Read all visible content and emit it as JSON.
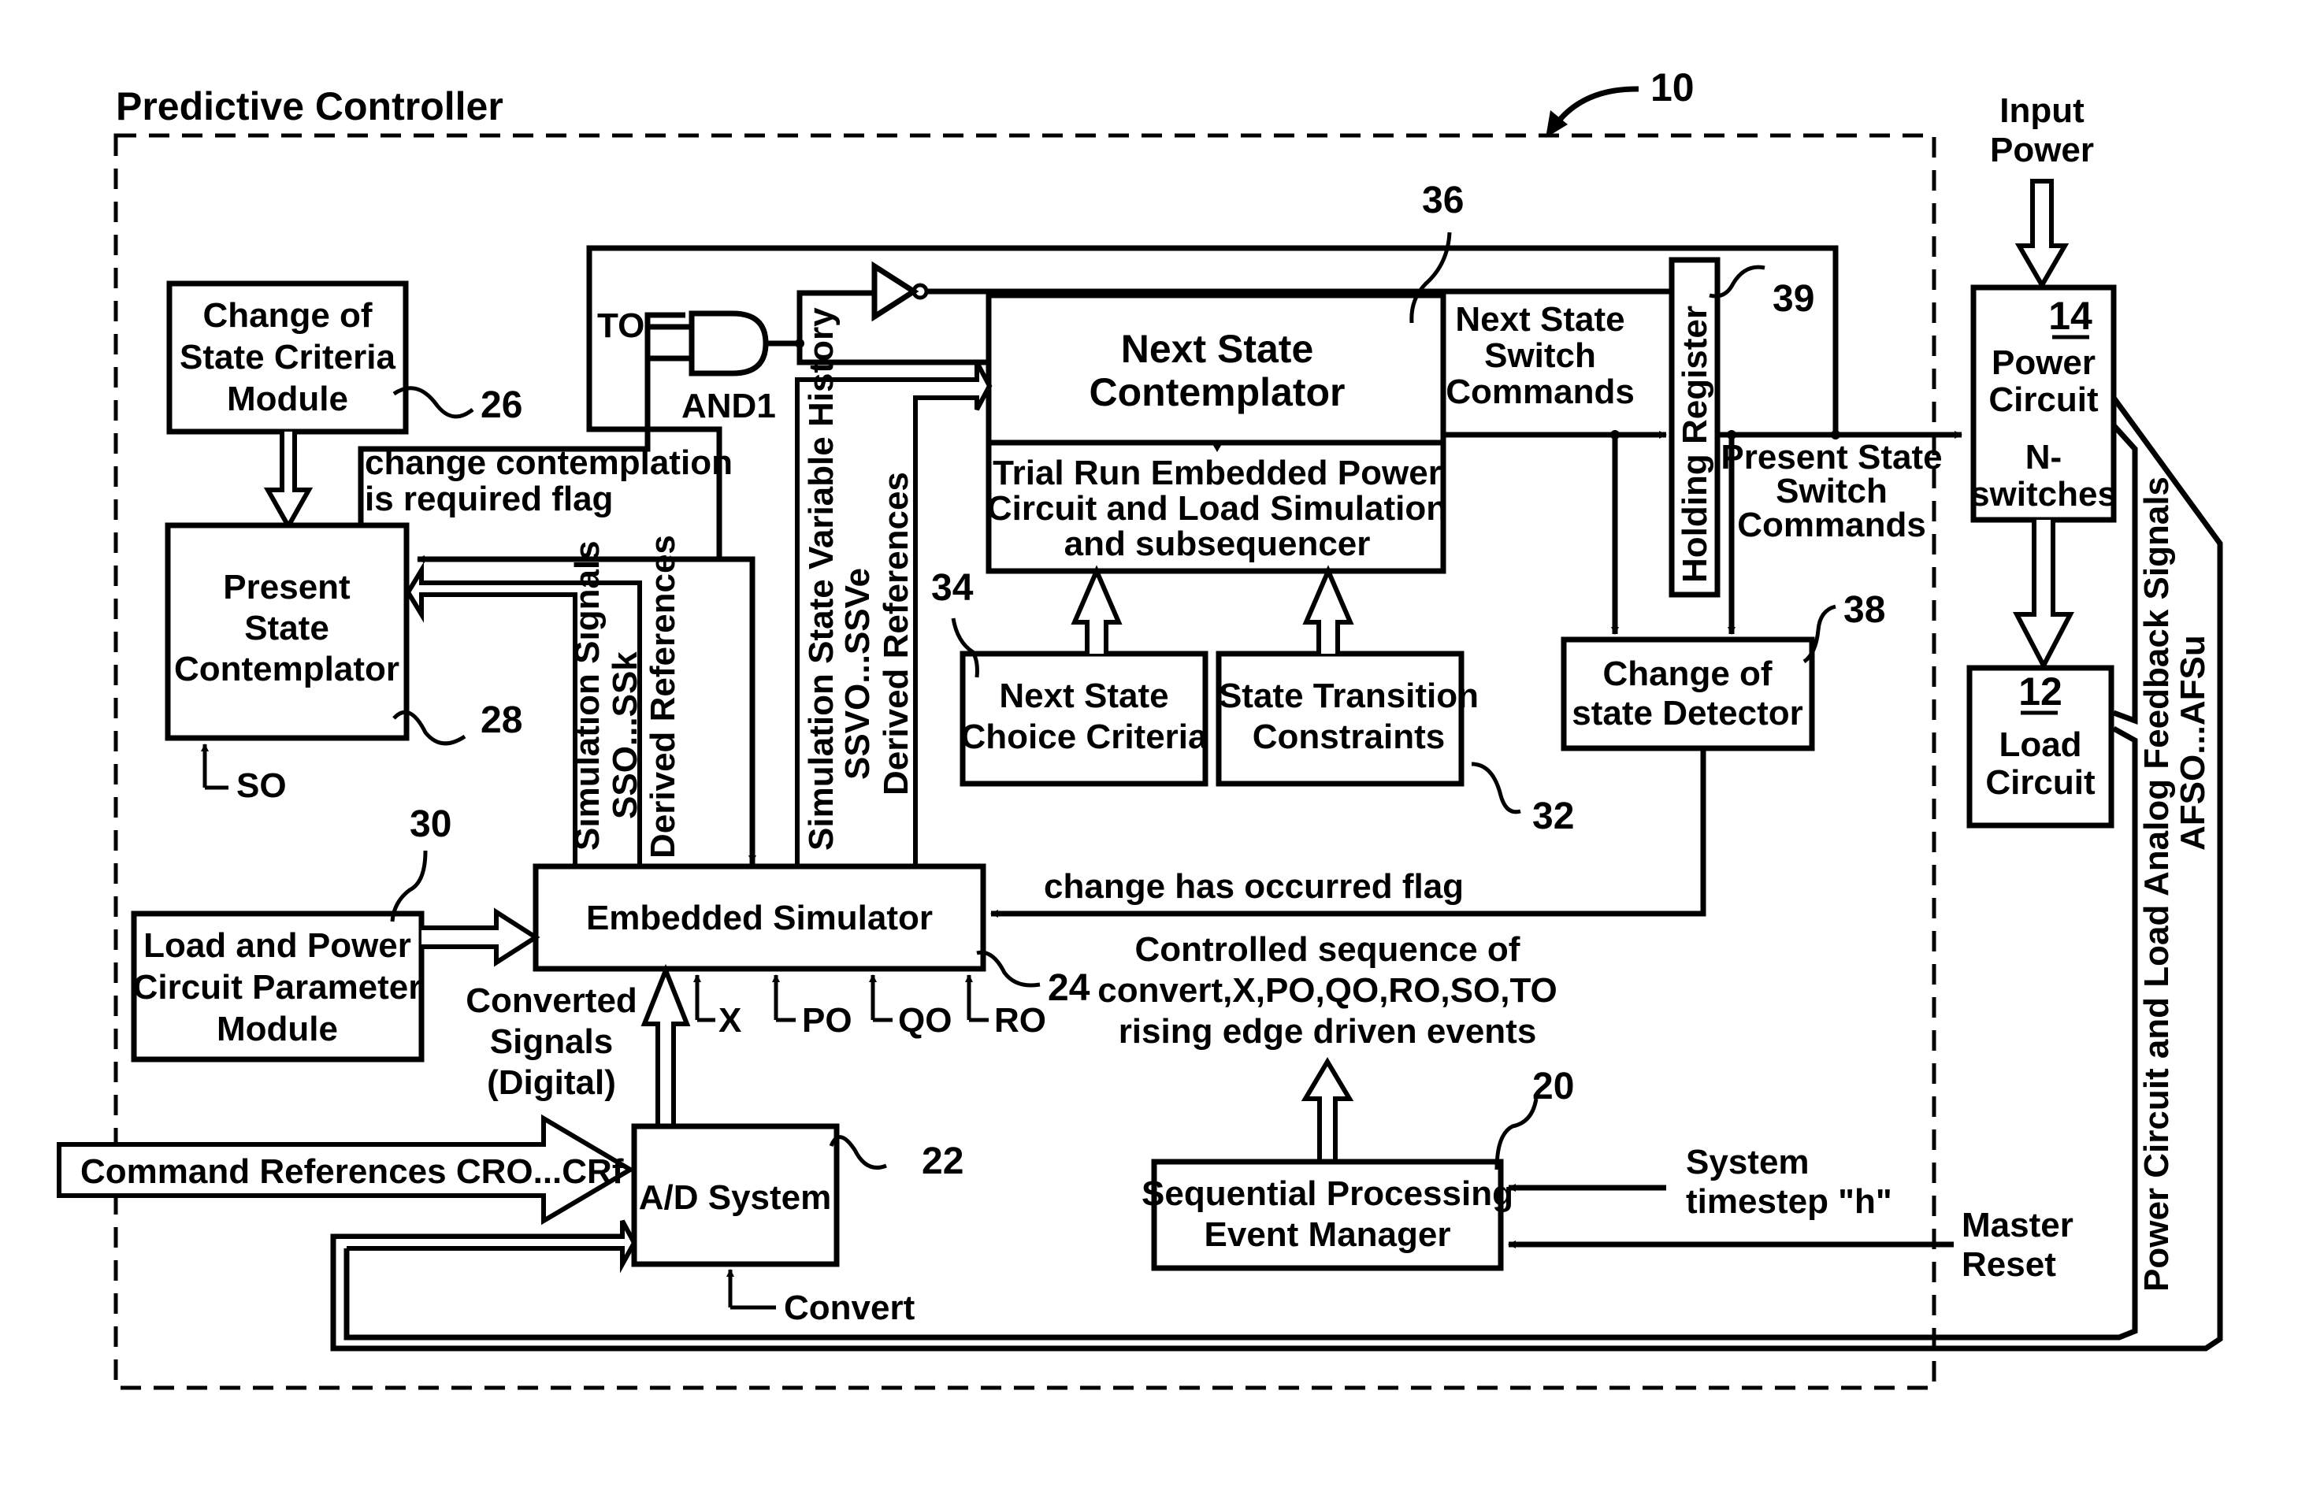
{
  "figure": {
    "title": "Predictive Controller",
    "ref_main": "10"
  },
  "blocks": {
    "change_criteria": {
      "lines": [
        "Change of",
        "State Criteria",
        "Module"
      ],
      "ref": "26"
    },
    "present_state": {
      "lines": [
        "Present",
        "State",
        "Contemplator"
      ],
      "ref": "28",
      "input": "SO"
    },
    "next_state": {
      "title_lines": [
        "Next State",
        "Contemplator"
      ],
      "sub_lines": [
        "Trial Run Embedded Power",
        "Circuit and Load Simulation",
        "and subsequencer"
      ],
      "ref": "36"
    },
    "holding_register": {
      "label": "Holding Register",
      "ref": "39"
    },
    "power_circuit": {
      "ref": "14",
      "lines": [
        "Power",
        "Circuit",
        "N-",
        "switches"
      ]
    },
    "load_circuit": {
      "ref": "12",
      "lines": [
        "Load",
        "Circuit"
      ]
    },
    "choice_criteria": {
      "lines": [
        "Next State",
        "Choice Criteria"
      ],
      "ref": "34"
    },
    "transition_constraints": {
      "lines": [
        "State Transition",
        "Constraints"
      ],
      "ref": "32"
    },
    "change_detector": {
      "lines": [
        "Change of",
        "state Detector"
      ],
      "ref": "38"
    },
    "embedded_simulator": {
      "label": "Embedded Simulator",
      "ref": "24",
      "inputs": [
        "X",
        "PO",
        "QO",
        "RO"
      ]
    },
    "param_module": {
      "lines": [
        "Load and Power",
        "Circuit Parameter",
        "Module"
      ],
      "ref": "30"
    },
    "ad_system": {
      "label": "A/D System",
      "ref": "22",
      "input": "Convert"
    },
    "event_manager": {
      "lines": [
        "Sequential Processing",
        "Event Manager"
      ],
      "ref": "20"
    }
  },
  "gates": {
    "and_gate": {
      "label": "AND1",
      "input": "TO"
    }
  },
  "signals": {
    "contemplation_flag": [
      "change contemplation",
      "is required flag"
    ],
    "sim_signals": [
      "Simulation Signals",
      "SSO...SSk",
      "Derived References"
    ],
    "sim_history": [
      "Simulation State Variable History",
      "SSVO...SSVe",
      "Derived References"
    ],
    "next_switch_cmds": [
      "Next State",
      "Switch",
      "Commands"
    ],
    "present_switch_cmds": [
      "Present State",
      "Switch",
      "Commands"
    ],
    "change_occurred": "change has occurred flag",
    "controlled_sequence": [
      "Controlled sequence of",
      "convert,X,PO,QO,RO,SO,TO",
      "rising edge driven events"
    ],
    "converted_signals": [
      "Converted",
      "Signals",
      "(Digital)"
    ],
    "command_refs": "Command References CRO...CRf",
    "system_timestep": [
      "System",
      "timestep \"h\""
    ],
    "master_reset": [
      "Master",
      "Reset"
    ],
    "input_power": [
      "Input",
      "Power"
    ],
    "feedback": [
      "Power Circuit and Load Analog Feedback Signals",
      "AFSO...AFSu"
    ]
  }
}
